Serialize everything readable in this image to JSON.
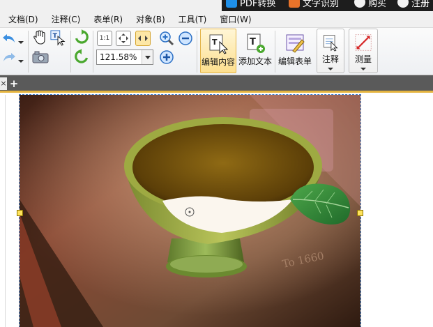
{
  "window": {
    "cloud_buttons": [
      {
        "label": "PDF转换",
        "icon": "pdf-convert-icon"
      },
      {
        "label": "文字识别",
        "icon": "eye-icon"
      },
      {
        "label": "购买",
        "icon": "plus-circle-icon"
      },
      {
        "label": "注册",
        "icon": "user-icon"
      }
    ]
  },
  "menu": [
    "文档(D)",
    "注释(C)",
    "表单(R)",
    "对象(B)",
    "工具(T)",
    "窗口(W)"
  ],
  "ribbon": {
    "zoom_value": "121.58%",
    "fit_actual_label": "1:1",
    "buttons": {
      "edit_content": "编辑内容",
      "add_text": "添加文本",
      "edit_form": "编辑表单",
      "annotate": "注释",
      "measure": "测量"
    }
  },
  "tabs": {
    "close": "×",
    "add": "+"
  },
  "document": {
    "image_text": "To 1660",
    "image_subject": "cup-of-tea-with-mint-photo"
  },
  "colors": {
    "accent": "#e4b440",
    "active_button_bg": "#fde7a6",
    "selection_outline": "#3c7fd1",
    "handle": "#ffe35c",
    "tab_bar": "#5a5a5a"
  }
}
